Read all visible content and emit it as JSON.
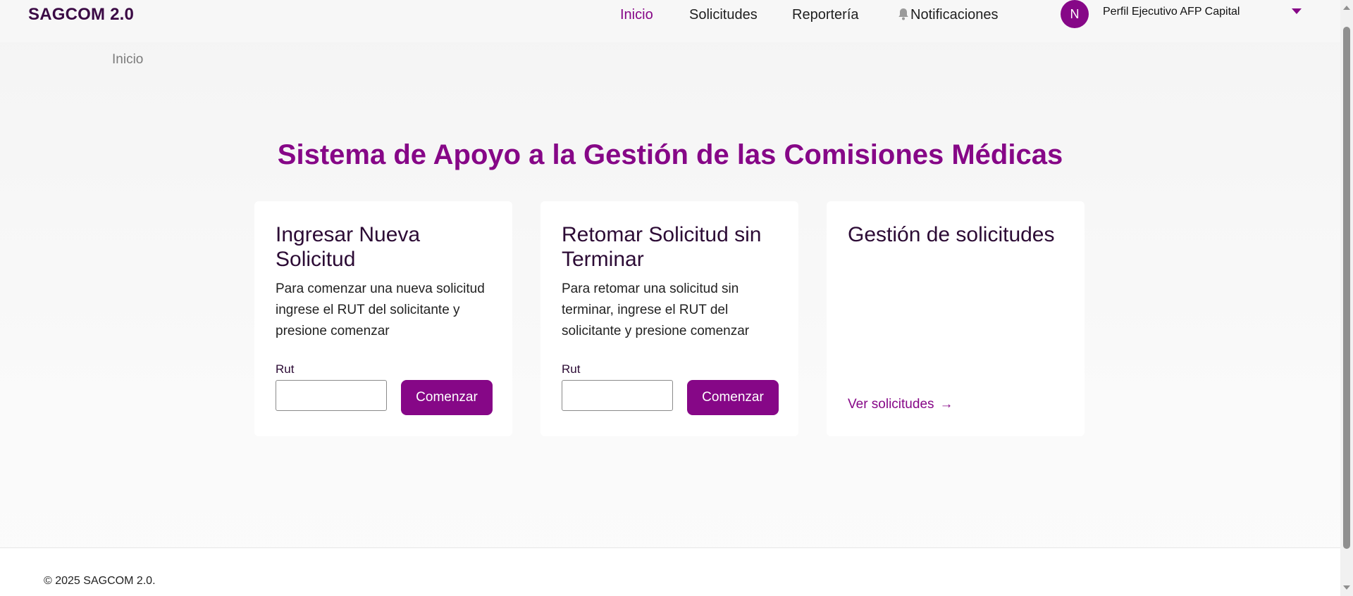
{
  "header": {
    "brand": "SAGCOM 2.0",
    "nav": [
      {
        "label": "Inicio",
        "active": true
      },
      {
        "label": "Solicitudes"
      },
      {
        "label": "Reportería"
      },
      {
        "label": "Notificaciones",
        "icon": "bell-icon"
      }
    ],
    "avatar_initial": "N",
    "profile_name": "Perfil Ejecutivo AFP Capital",
    "menu_icon": "caret-down-icon"
  },
  "breadcrumb": "Inicio",
  "title": "Sistema de Apoyo a la Gestión de las Comisiones Médicas",
  "cards": [
    {
      "title": "Ingresar Nueva Solicitud",
      "text": "Para comenzar una nueva solicitud ingrese el RUT del solicitante y presione comenzar",
      "field_label": "Rut",
      "input_value": "",
      "button": "Comenzar"
    },
    {
      "title": "Retomar Solicitud sin Terminar",
      "text": "Para retomar una solicitud sin terminar, ingrese el RUT del solicitante y presione comenzar",
      "field_label": "Rut",
      "input_value": "",
      "button": "Comenzar"
    },
    {
      "title": "Gestión de solicitudes",
      "link": "Ver solicitudes",
      "link_icon": "arrow-right-icon"
    }
  ],
  "footer": {
    "copyright": "© 2025 SAGCOM 2.0."
  },
  "colors": {
    "accent": "#860787",
    "brand_text": "#3b0a45"
  }
}
